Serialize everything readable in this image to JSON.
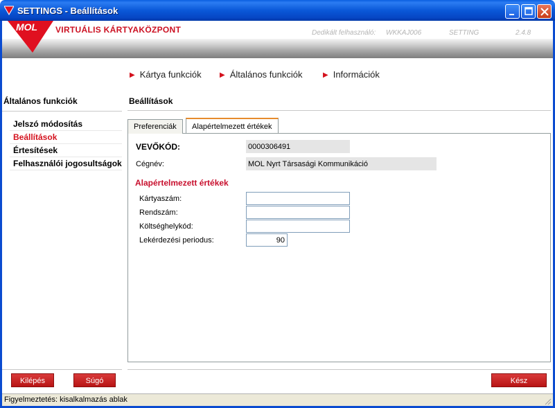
{
  "window": {
    "title": "SETTINGS - Beállítások"
  },
  "banner": {
    "brand": "VIRTUÁLIS KÁRTYAKÖZPONT",
    "meta_user": "Dedikált felhasználó:",
    "meta_code": "WKKAJ006",
    "meta_module": "SETTING",
    "meta_version": "2.4.8"
  },
  "topnav": {
    "items": [
      {
        "label": "Kártya funkciók"
      },
      {
        "label": "Általános funkciók"
      },
      {
        "label": "Információk"
      }
    ]
  },
  "sidebar": {
    "heading": "Általános funkciók",
    "items": [
      {
        "label": "Jelszó módosítás"
      },
      {
        "label": "Beállítások",
        "active": true
      },
      {
        "label": "Értesítések"
      },
      {
        "label": "Felhasználói jogosultságok"
      }
    ]
  },
  "main": {
    "heading": "Beállítások",
    "tabs": [
      {
        "label": "Preferenciák"
      },
      {
        "label": "Alapértelmezett értékek",
        "active": true
      }
    ],
    "customer": {
      "code_label": "VEVŐKÓD:",
      "code_value": "0000306491",
      "company_label": "Cégnév:",
      "company_value": "MOL Nyrt Társasági Kommunikáció"
    },
    "defaults": {
      "section_title": "Alapértelmezett értékek",
      "card_label": "Kártyaszám:",
      "card_value": "",
      "plate_label": "Rendszám:",
      "plate_value": "",
      "cost_label": "Költséghelykód:",
      "cost_value": "",
      "period_label": "Lekérdezési periodus:",
      "period_value": "90"
    }
  },
  "buttons": {
    "exit": "Kilépés",
    "help": "Súgó",
    "done": "Kész"
  },
  "statusbar": {
    "text": "Figyelmeztetés: kisalkalmazás ablak"
  },
  "colors": {
    "brand_red": "#d4121e",
    "titlebar_blue": "#0a58d8",
    "tab_accent": "#e68b2c"
  },
  "icons": {
    "app": "mol-triangle-icon",
    "minimize": "minimize-icon",
    "maximize": "maximize-icon",
    "close": "close-icon",
    "nav_arrow": "red-triangle-bullet-icon"
  }
}
